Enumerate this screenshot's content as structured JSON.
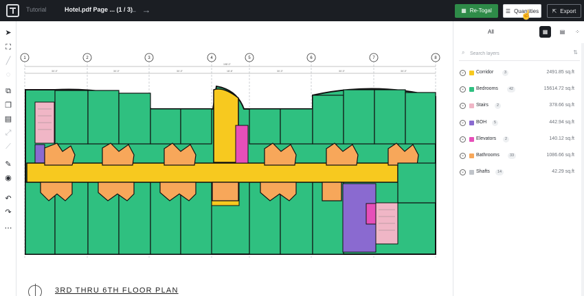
{
  "topbar": {
    "workspace": "Tutorial",
    "filename": "Hotel.pdf Page ... (1 / 3)",
    "back_icon": "arrow-left-icon",
    "forward_icon": "arrow-right-icon",
    "retogal_label": "Re-Togal",
    "quantities_label": "Quantities",
    "export_label": "Export"
  },
  "colors": {
    "topbar": "#1b1e23",
    "accent_green": "#2e8b48",
    "corridor": "#f7c91f",
    "bedrooms": "#2fc080",
    "stairs": "#f0b6c6",
    "boh": "#8a6ad0",
    "elevators": "#e64fb9",
    "bathrooms": "#f7a75a",
    "shafts": "#c0c4ca"
  },
  "plan": {
    "title": "3RD THRU 6TH FLOOR PLAN",
    "grid_labels": [
      "1",
      "2",
      "3",
      "4",
      "5",
      "6",
      "7",
      "8"
    ]
  },
  "panel": {
    "tab_all": "All",
    "search_placeholder": "Search layers",
    "layers": [
      {
        "name": "Corridor",
        "count": "3",
        "area": "2491.85 sq.ft",
        "color": "#f7c91f"
      },
      {
        "name": "Bedrooms",
        "count": "42",
        "area": "15614.72 sq.ft",
        "color": "#2fc080"
      },
      {
        "name": "Stairs",
        "count": "2",
        "area": "378.66 sq.ft",
        "color": "#f0b6c6"
      },
      {
        "name": "BOH",
        "count": "5",
        "area": "442.94 sq.ft",
        "color": "#8a6ad0"
      },
      {
        "name": "Elevators",
        "count": "2",
        "area": "140.12 sq.ft",
        "color": "#e64fb9"
      },
      {
        "name": "Bathrooms",
        "count": "33",
        "area": "1086.66 sq.ft",
        "color": "#f7a75a"
      },
      {
        "name": "Shafts",
        "count": "14",
        "area": "42.29 sq.ft",
        "color": "#c0c4ca"
      }
    ]
  },
  "toolbar": {
    "tools": [
      "pointer-icon",
      "crop-icon",
      "line-icon",
      "circle-icon",
      "copy-icon",
      "duplicate-icon",
      "stack-icon",
      "scale-icon",
      "ruler-icon",
      "pen-icon",
      "target-icon",
      "undo-icon",
      "redo-icon",
      "more-icon"
    ]
  }
}
